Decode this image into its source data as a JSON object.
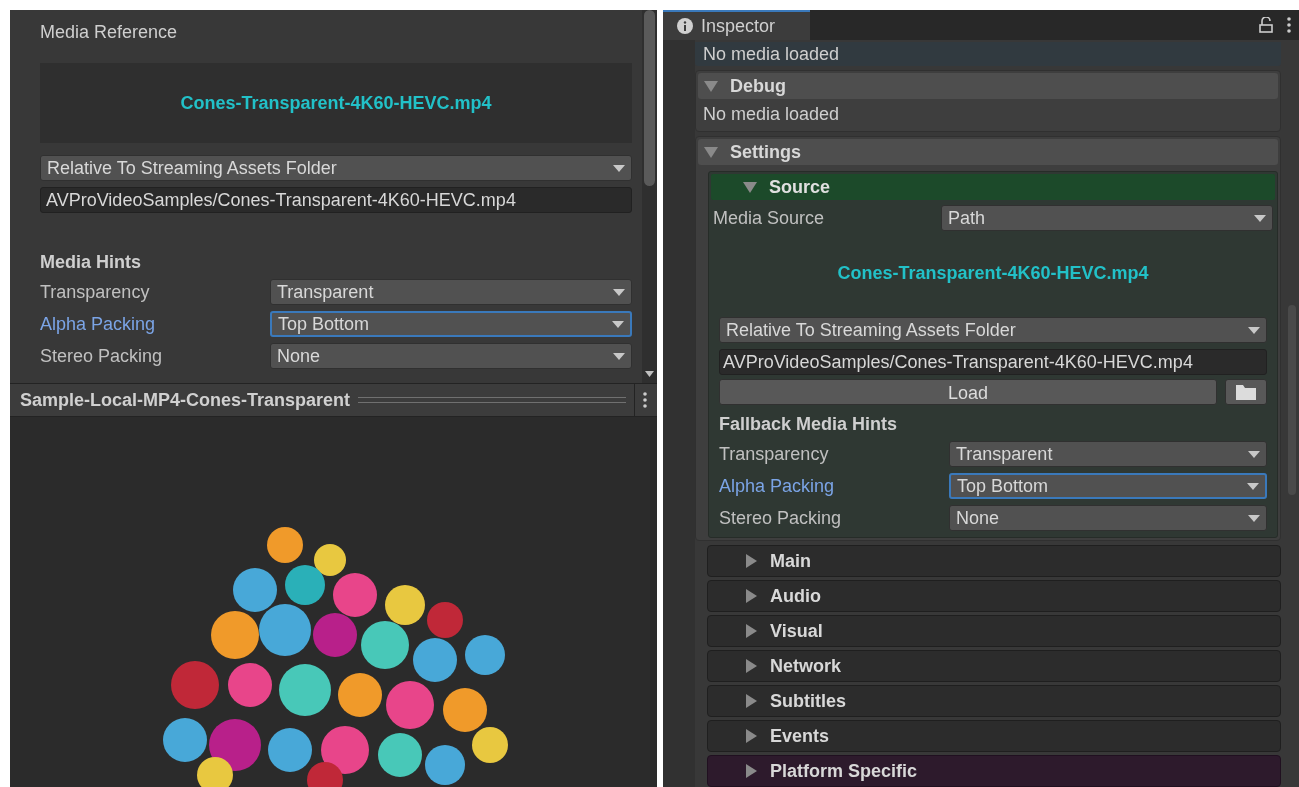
{
  "media_panel": {
    "title": "Media Reference",
    "file_name": "Cones-Transparent-4K60-HEVC.mp4",
    "path_mode": "Relative To Streaming Assets Folder",
    "path": "AVProVideoSamples/Cones-Transparent-4K60-HEVC.mp4",
    "hints_title": "Media Hints",
    "hints": [
      {
        "label": "Transparency",
        "value": "Transparent",
        "focused": false
      },
      {
        "label": "Alpha Packing",
        "value": "Top Bottom",
        "focused": true
      },
      {
        "label": "Stereo Packing",
        "value": "None",
        "focused": false
      }
    ]
  },
  "preview": {
    "title": "Sample-Local-MP4-Cones-Transparent"
  },
  "inspector": {
    "tab": "Inspector",
    "status_message": "No media loaded",
    "debug": {
      "title": "Debug",
      "expanded": true,
      "message": "No media loaded"
    },
    "settings": {
      "title": "Settings",
      "expanded": true,
      "source": {
        "title": "Source",
        "expanded": true,
        "media_source_label": "Media Source",
        "media_source_value": "Path",
        "file_name": "Cones-Transparent-4K60-HEVC.mp4",
        "path_mode": "Relative To Streaming Assets Folder",
        "path": "AVProVideoSamples/Cones-Transparent-4K60-HEVC.mp4",
        "load_button": "Load",
        "hints_title": "Fallback Media Hints",
        "hints": [
          {
            "label": "Transparency",
            "value": "Transparent",
            "focused": false
          },
          {
            "label": "Alpha Packing",
            "value": "Top Bottom",
            "focused": true
          },
          {
            "label": "Stereo Packing",
            "value": "None",
            "focused": false
          }
        ]
      }
    },
    "sections": [
      {
        "title": "Main",
        "kind": "normal",
        "expanded": false
      },
      {
        "title": "Audio",
        "kind": "normal",
        "expanded": false
      },
      {
        "title": "Visual",
        "kind": "normal",
        "expanded": false
      },
      {
        "title": "Network",
        "kind": "normal",
        "expanded": false
      },
      {
        "title": "Subtitles",
        "kind": "normal",
        "expanded": false
      },
      {
        "title": "Events",
        "kind": "normal",
        "expanded": false
      },
      {
        "title": "Platform Specific",
        "kind": "platform",
        "expanded": false
      }
    ]
  }
}
